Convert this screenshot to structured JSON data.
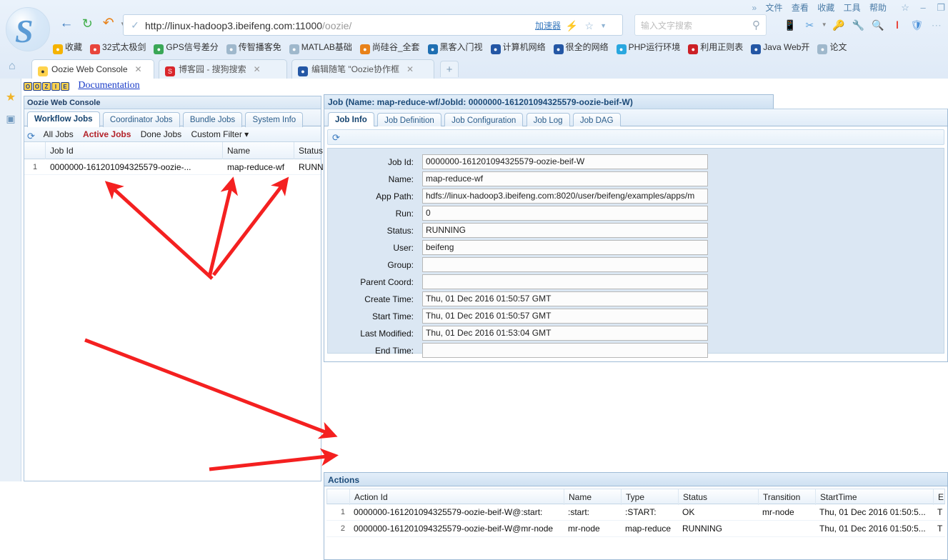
{
  "browser": {
    "url_main": "http://linux-hadoop3.ibeifeng.com:11000",
    "url_path": "/oozie/",
    "accelerator": "加速器",
    "search_placeholder": "输入文字搜索",
    "menu": [
      "文件",
      "查看",
      "收藏",
      "工具",
      "帮助"
    ],
    "chevron": "»",
    "bookmarks": [
      {
        "label": "收藏",
        "icon": "star-icon",
        "color": "#f5b301"
      },
      {
        "label": "32式太极剑",
        "icon": "video-icon",
        "color": "#e8453c"
      },
      {
        "label": "GPS信号差分",
        "icon": "link-icon",
        "color": "#3aa757"
      },
      {
        "label": "传智播客免",
        "icon": "page-icon",
        "color": "#9fb8cc"
      },
      {
        "label": "MATLAB基础",
        "icon": "page-icon",
        "color": "#9fb8cc"
      },
      {
        "label": "尚硅谷_全套",
        "icon": "u-icon",
        "color": "#e8821a"
      },
      {
        "label": "黑客入门视",
        "icon": "globe-icon",
        "color": "#1f6fb2"
      },
      {
        "label": "计算机网络",
        "icon": "baidu-icon",
        "color": "#2457a5"
      },
      {
        "label": "很全的网络",
        "icon": "baidu-icon",
        "color": "#2457a5"
      },
      {
        "label": "PHP运行环境",
        "icon": "php-icon",
        "color": "#29a7df"
      },
      {
        "label": "利用正则表",
        "icon": "c-icon",
        "color": "#cc2026"
      },
      {
        "label": "Java Web开",
        "icon": "blog-icon",
        "color": "#2457a5"
      },
      {
        "label": "论文",
        "icon": "folder-icon",
        "color": "#9fb8cc"
      }
    ],
    "tabs": [
      {
        "title": "Oozie Web Console",
        "active": true,
        "favicon_color": "#ffd34d"
      },
      {
        "title": "博客园 - 搜狗搜索",
        "active": false,
        "favicon_color": "#d9262b"
      },
      {
        "title": "编辑随笔 \"Oozie协作框",
        "active": false,
        "favicon_color": "#2457a5"
      }
    ],
    "new_tab_label": "+",
    "window_buttons": [
      "☆",
      "–",
      "❐"
    ],
    "toolbar_icons": [
      "cast-icon",
      "scissors-icon",
      "key-icon",
      "wrench-icon",
      "screenshot-icon",
      "sogou-icon",
      "shield-icon",
      "more-icon"
    ],
    "urlbar_icons": [
      "lightning-icon",
      "star-icon",
      "chevron-down-icon"
    ]
  },
  "left_rail": {
    "icons": [
      "favorites-star-icon",
      "reading-pane-icon"
    ]
  },
  "oozie_header": {
    "badge_letters": [
      "O",
      "O",
      "Z",
      "I",
      "E"
    ],
    "documentation_link": "Documentation"
  },
  "console": {
    "title": "Oozie Web Console",
    "tabs": [
      {
        "label": "Workflow Jobs",
        "active": true
      },
      {
        "label": "Coordinator Jobs",
        "active": false
      },
      {
        "label": "Bundle Jobs",
        "active": false
      },
      {
        "label": "System Info",
        "active": false
      }
    ],
    "filters": [
      {
        "label": "All Jobs",
        "selected": false
      },
      {
        "label": "Active Jobs",
        "selected": true
      },
      {
        "label": "Done Jobs",
        "selected": false
      },
      {
        "label": "Custom Filter ▾",
        "selected": false
      }
    ],
    "columns": [
      "Job Id",
      "Name",
      "Status"
    ],
    "rows": [
      {
        "num": "1",
        "job_id": "0000000-161201094325579-oozie-...",
        "name": "map-reduce-wf",
        "status": "RUNNING"
      }
    ]
  },
  "job": {
    "title": "Job (Name: map-reduce-wf/JobId: 0000000-161201094325579-oozie-beif-W)",
    "tabs": [
      {
        "label": "Job Info",
        "active": true
      },
      {
        "label": "Job Definition",
        "active": false
      },
      {
        "label": "Job Configuration",
        "active": false
      },
      {
        "label": "Job Log",
        "active": false
      },
      {
        "label": "Job DAG",
        "active": false
      }
    ],
    "fields": [
      {
        "label": "Job Id:",
        "value": "0000000-161201094325579-oozie-beif-W"
      },
      {
        "label": "Name:",
        "value": "map-reduce-wf"
      },
      {
        "label": "App Path:",
        "value": "hdfs://linux-hadoop3.ibeifeng.com:8020/user/beifeng/examples/apps/m"
      },
      {
        "label": "Run:",
        "value": "0"
      },
      {
        "label": "Status:",
        "value": "RUNNING"
      },
      {
        "label": "User:",
        "value": "beifeng"
      },
      {
        "label": "Group:",
        "value": ""
      },
      {
        "label": "Parent Coord:",
        "value": ""
      },
      {
        "label": "Create Time:",
        "value": "Thu, 01 Dec 2016 01:50:57 GMT"
      },
      {
        "label": "Start Time:",
        "value": "Thu, 01 Dec 2016 01:50:57 GMT"
      },
      {
        "label": "Last Modified:",
        "value": "Thu, 01 Dec 2016 01:53:04 GMT"
      },
      {
        "label": "End Time:",
        "value": ""
      }
    ]
  },
  "actions": {
    "title": "Actions",
    "columns": [
      "Action Id",
      "Name",
      "Type",
      "Status",
      "Transition",
      "StartTime",
      "E"
    ],
    "rows": [
      {
        "num": "1",
        "action_id": "0000000-161201094325579-oozie-beif-W@:start:",
        "name": ":start:",
        "type": ":START:",
        "status": "OK",
        "transition": "mr-node",
        "start_time": "Thu, 01 Dec 2016 01:50:5...",
        "end_time": "T"
      },
      {
        "num": "2",
        "action_id": "0000000-161201094325579-oozie-beif-W@mr-node",
        "name": "mr-node",
        "type": "map-reduce",
        "status": "RUNNING",
        "transition": "",
        "start_time": "Thu, 01 Dec 2016 01:50:5...",
        "end_time": "T"
      }
    ]
  },
  "annotations": {
    "arrow_color": "#f42020",
    "count": 5
  }
}
